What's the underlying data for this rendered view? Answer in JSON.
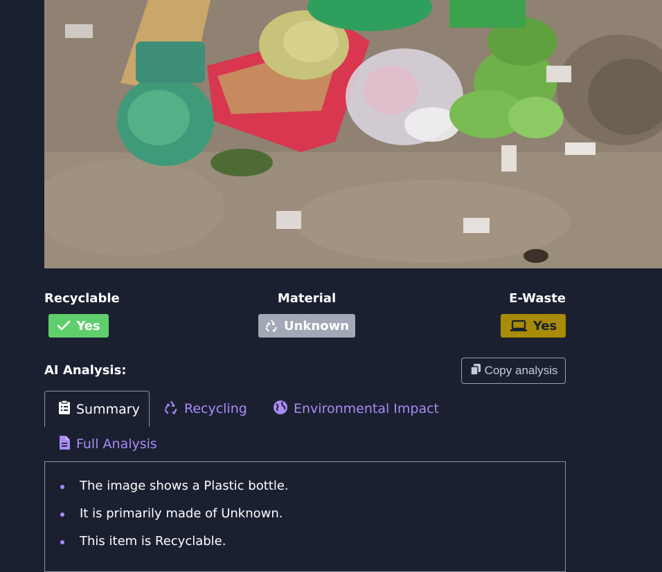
{
  "photo": {
    "alt": ""
  },
  "stats": {
    "recyclable": {
      "label": "Recyclable",
      "value": "Yes",
      "icon": "check-icon",
      "color": "#5fcf6c"
    },
    "material": {
      "label": "Material",
      "value": "Unknown",
      "icon": "recycle-icon",
      "color": "#a3a8b6"
    },
    "ewaste": {
      "label": "E-Waste",
      "value": "Yes",
      "icon": "laptop-icon",
      "color": "#a88b06"
    }
  },
  "analysis": {
    "heading": "AI Analysis:",
    "copy_label": "Copy analysis",
    "tabs": [
      {
        "label": "Summary",
        "icon": "clipboard-list-icon",
        "active": true
      },
      {
        "label": "Recycling",
        "icon": "recycle-icon",
        "active": false
      },
      {
        "label": "Environmental Impact",
        "icon": "globe-icon",
        "active": false
      },
      {
        "label": "Full Analysis",
        "icon": "document-icon",
        "active": false
      }
    ],
    "summary_items": [
      "The image shows a Plastic bottle.",
      "It is primarily made of Unknown.",
      "This item is Recyclable."
    ]
  },
  "colors": {
    "background": "#1b2031",
    "accent": "#a98bf5",
    "border": "#8d93a3"
  }
}
